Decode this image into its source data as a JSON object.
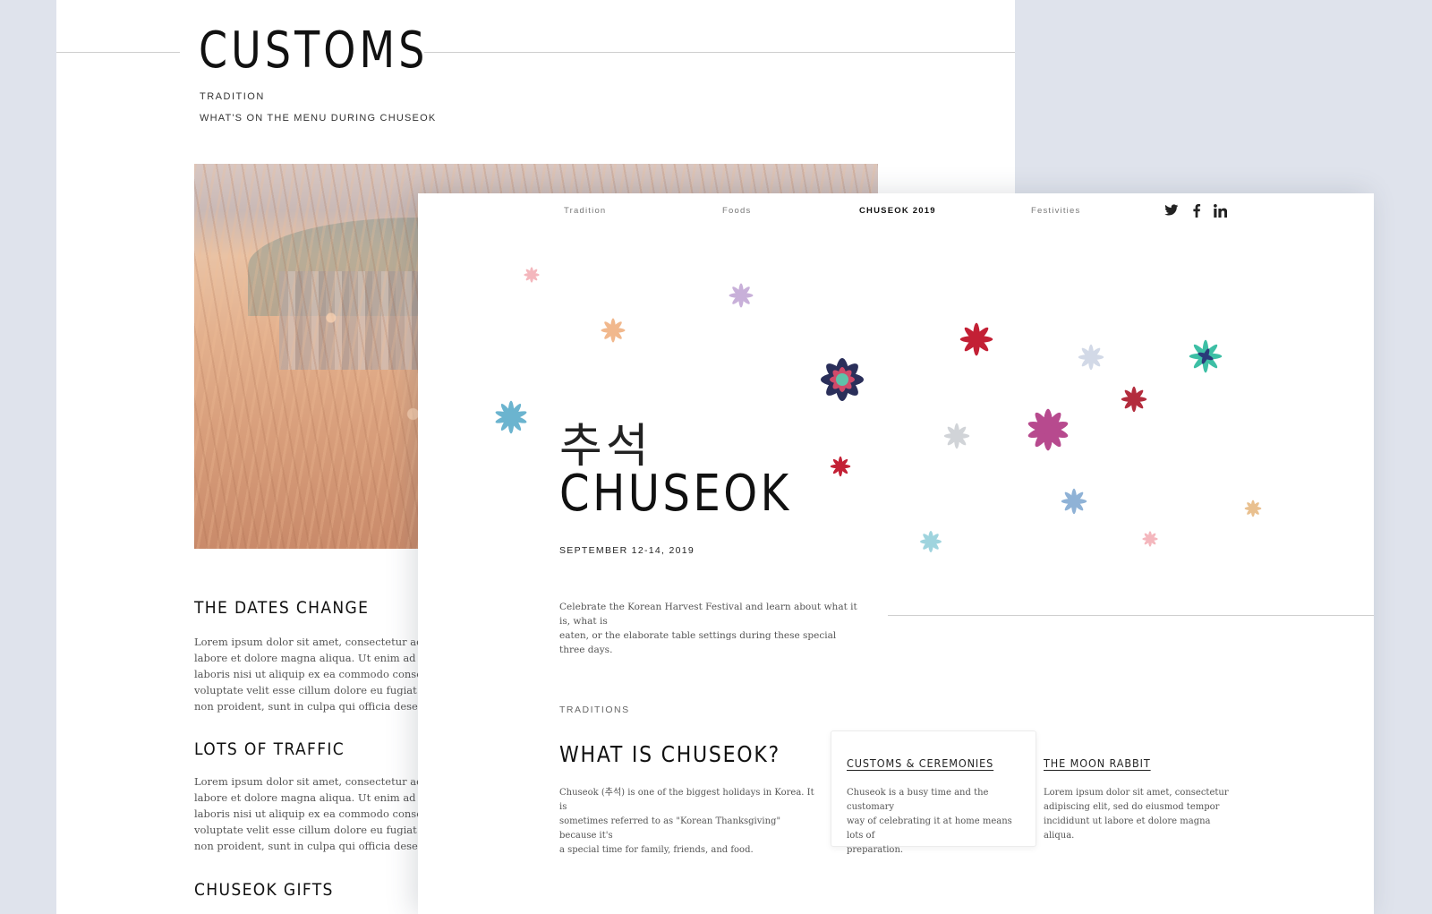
{
  "back_page": {
    "title": "CUSTOMS",
    "kicker": "TRADITION",
    "subtitle": "WHAT'S ON THE MENU DURING CHUSEOK",
    "sections": [
      {
        "heading": "THE DATES CHANGE",
        "lines": [
          "Lorem ipsum dolor sit amet, consectetur adipisc",
          "labore et dolore magna aliqua. Ut enim ad minim",
          "laboris nisi ut aliquip ex ea commodo consequat",
          "voluptate velit esse cillum dolore eu fugiat nulla",
          "non proident, sunt in culpa qui officia deserunt m"
        ]
      },
      {
        "heading": "LOTS OF TRAFFIC",
        "lines": [
          "Lorem ipsum dolor sit amet, consectetur adipisc",
          "labore et dolore magna aliqua. Ut enim ad minim",
          "laboris nisi ut aliquip ex ea commodo consequat",
          "voluptate velit esse cillum dolore eu fugiat nulla",
          "non proident, sunt in culpa qui officia deserunt m"
        ]
      },
      {
        "heading": "CHUSEOK GIFTS"
      }
    ]
  },
  "nav": {
    "items": [
      "Tradition",
      "Foods",
      "CHUSEOK 2019",
      "Festivities"
    ],
    "active_index": 2,
    "social": [
      "twitter-icon",
      "facebook-icon",
      "linkedin-icon"
    ]
  },
  "hero": {
    "hangul": "추석",
    "title": "CHUSEOK",
    "date": "SEPTEMBER 12-14, 2019",
    "intro_lines": [
      "Celebrate the Korean Harvest Festival and learn about what it is, what is",
      "eaten, or the elaborate table settings during these special three days."
    ]
  },
  "traditions": {
    "kicker": "TRADITIONS",
    "title": "WHAT IS CHUSEOK?",
    "text_lines": [
      "Chuseok (추석) is one of the biggest holidays in Korea. It is",
      "sometimes referred to as \"Korean Thanksgiving\" because it's",
      "a special time for family, friends, and food."
    ],
    "cards": [
      {
        "title": "CUSTOMS & CEREMONIES",
        "lines": [
          "Chuseok is a busy time and the customary",
          "way of celebrating it at home means lots of",
          "preparation."
        ]
      },
      {
        "title": "THE MOON RABBIT",
        "lines": [
          "Lorem ipsum dolor sit amet, consectetur",
          "adipiscing elit, sed do eiusmod tempor",
          "incididunt ut labore et dolore magna aliqua."
        ]
      }
    ]
  },
  "colors": {
    "background": "#dfe3ec",
    "ink": "#111111",
    "muted": "#555555",
    "flower_palette": [
      "#f4b7bd",
      "#c8b0d9",
      "#f1b88d",
      "#6bb4cf",
      "#c32035",
      "#d2d9e7",
      "#3dbfa5",
      "#b74a8e",
      "#8fb2d6",
      "#e9c08f",
      "#d1d4d8"
    ]
  }
}
